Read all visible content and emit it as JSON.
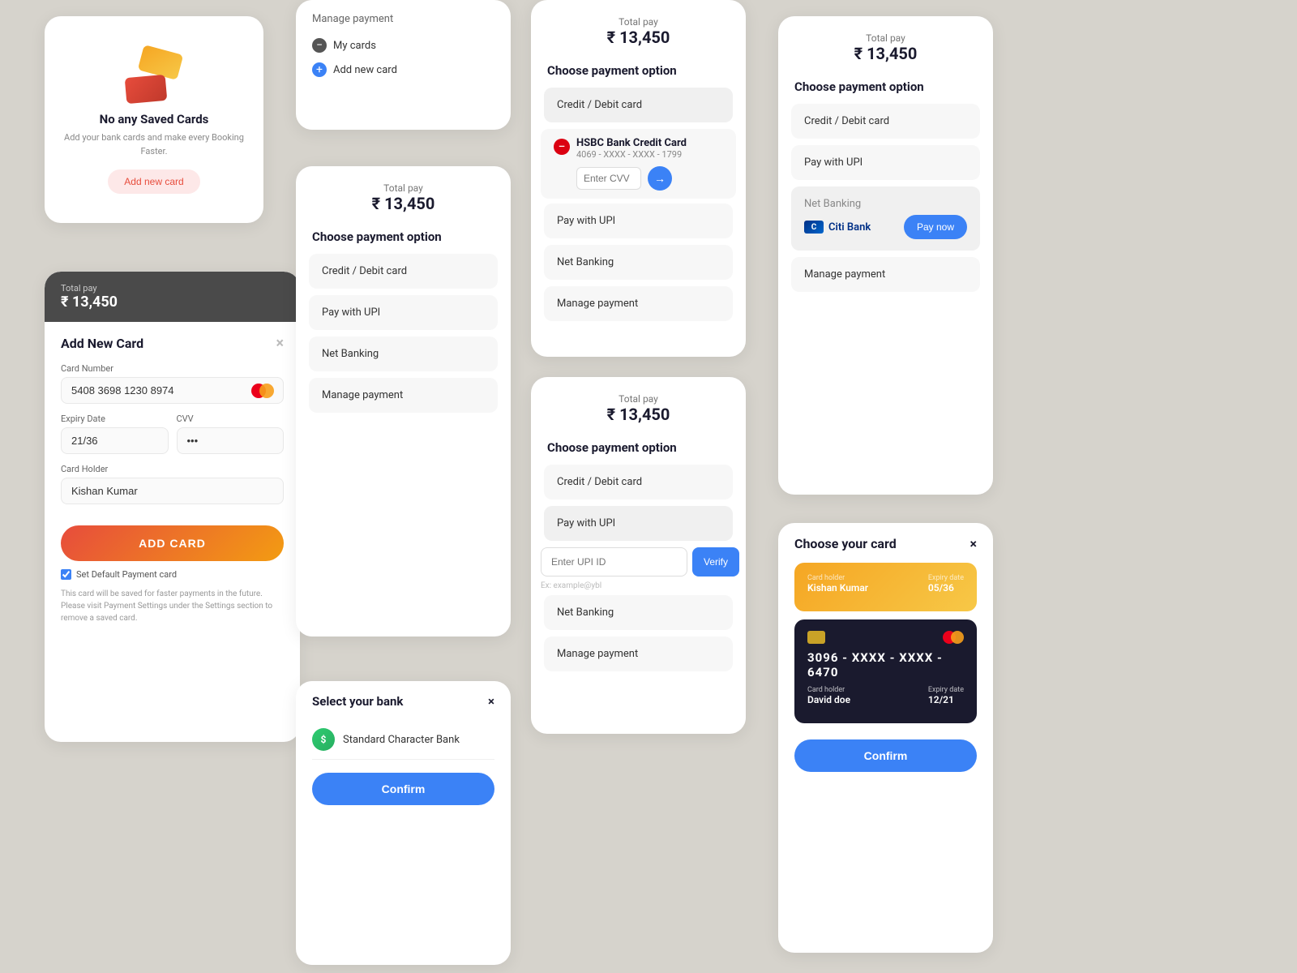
{
  "panels": {
    "no_cards": {
      "title": "No any Saved Cards",
      "description": "Add your bank cards and make every Booking Faster.",
      "add_button_label": "Add new card"
    },
    "add_card_form": {
      "header": {
        "total_label": "Total pay",
        "total_amount": "₹ 13,450"
      },
      "title": "Add New Card",
      "card_number_label": "Card Number",
      "card_number_value": "5408 3698 1230 8974",
      "expiry_label": "Expiry Date",
      "expiry_value": "21/36",
      "cvv_label": "CVV",
      "cvv_value": "•••",
      "holder_label": "Card Holder",
      "holder_value": "Kishan Kumar",
      "add_button_label": "ADD CARD",
      "default_checkbox_label": "Set Default Payment card",
      "disclaimer": "This card will be saved for faster payments in the future. Please visit Payment Settings under the Settings section to remove a saved card."
    },
    "manage_payment": {
      "title": "Manage payment",
      "items": [
        {
          "label": "My cards",
          "icon": "minus"
        },
        {
          "label": "Add new card",
          "icon": "plus"
        }
      ]
    },
    "payment_options_simple": {
      "total_label": "Total pay",
      "total_amount": "₹ 13,450",
      "section_title": "Choose payment option",
      "options": [
        {
          "label": "Credit / Debit card"
        },
        {
          "label": "Pay with UPI"
        },
        {
          "label": "Net Banking"
        },
        {
          "label": "Manage payment"
        }
      ]
    },
    "payment_with_hsbc": {
      "total_label": "Total pay",
      "total_amount": "₹ 13,450",
      "section_title": "Choose payment option",
      "card_type_label": "Credit / Debit card",
      "bank_name": "HSBC Bank Credit Card",
      "card_number": "4069 - XXXX - XXXX - 1799",
      "cvv_placeholder": "Enter CVV",
      "options": [
        {
          "label": "Pay with UPI"
        },
        {
          "label": "Net Banking"
        },
        {
          "label": "Manage payment"
        }
      ]
    },
    "payment_with_upi": {
      "total_label": "Total pay",
      "total_amount": "₹ 13,450",
      "section_title": "Choose payment option",
      "options": [
        {
          "label": "Credit / Debit card"
        },
        {
          "label": "Pay with UPI"
        }
      ],
      "upi_placeholder": "Enter UPI ID",
      "upi_hint": "Ex: example@ybl",
      "verify_button": "Verify",
      "options2": [
        {
          "label": "Net Banking"
        },
        {
          "label": "Manage payment"
        }
      ]
    },
    "right_payment": {
      "total_label": "Total pay",
      "total_amount": "₹ 13,450",
      "section_title": "Choose payment option",
      "options": [
        {
          "label": "Credit / Debit card"
        },
        {
          "label": "Pay with UPI"
        },
        {
          "label": "Net Banking"
        },
        {
          "label": "Manage payment"
        }
      ],
      "net_banking_bank": "Citi Bank",
      "pay_now_label": "Pay now"
    },
    "choose_card": {
      "title": "Choose your card",
      "cards": [
        {
          "holder_label": "Card holder",
          "holder_name": "Kishan Kumar",
          "expiry_label": "Expiry date",
          "expiry_value": "05/36",
          "type": "gold"
        },
        {
          "number": "3096 - XXXX - XXXX - 6470",
          "holder_label": "Card holder",
          "holder_name": "David doe",
          "expiry_label": "Expiry date",
          "expiry_value": "12/21",
          "type": "dark"
        }
      ]
    },
    "select_bank": {
      "title": "Select your bank",
      "bank_name": "Standard Character Bank",
      "confirm_label": "Confirm"
    }
  },
  "icons": {
    "close": "×",
    "arrow_right": "→",
    "minus": "−",
    "plus": "+"
  }
}
